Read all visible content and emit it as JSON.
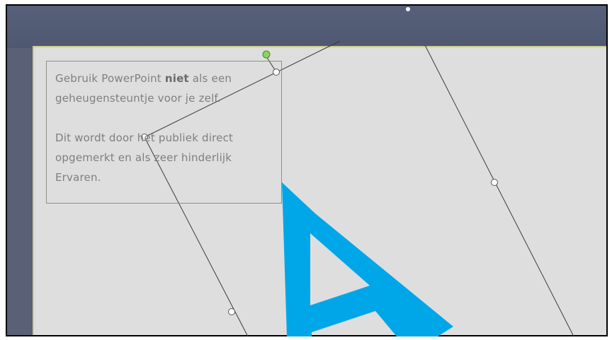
{
  "slide": {
    "textbox": {
      "para1_before": "Gebruik PowerPoint ",
      "para1_bold": "niet",
      "para1_after": " als een geheugensteuntje voor je zelf.",
      "para2": "Dit wordt door het publiek direct opgemerkt en als zeer hinderlijk Ervaren."
    },
    "wordart_letter": "A",
    "colors": {
      "wordart_fill": "#00a7e8",
      "slide_background": "#dedede",
      "window_background": "#56607a",
      "rotation_handle": "#8bd35a"
    }
  }
}
